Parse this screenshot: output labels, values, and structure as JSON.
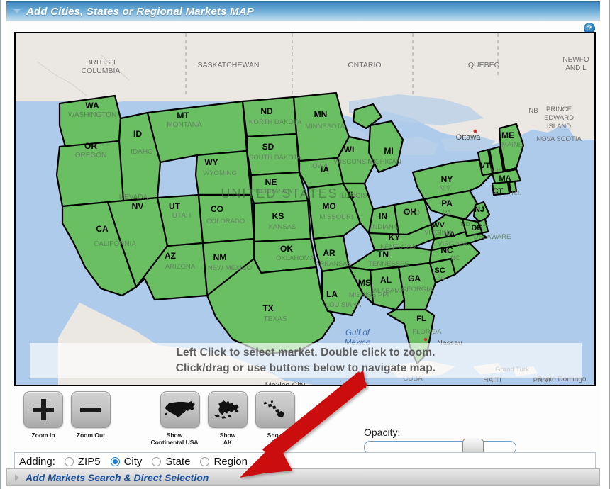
{
  "header": {
    "title": "Add Cities, States or Regional Markets MAP",
    "caret_icon": "triangle-down-icon",
    "help_icon": "help-question-icon",
    "help_label": "?"
  },
  "map": {
    "overlay_line1": "Left Click to select market. Double click to zoom.",
    "overlay_line2": "Click/drag or use buttons below to navigate map.",
    "colors": {
      "selected_state": "#6BBF63",
      "state_border": "#000000",
      "ocean": "#aecbeb",
      "land": "#ebe8e3"
    },
    "states": [
      {
        "abbr": "WA",
        "name": "WASHINGTON"
      },
      {
        "abbr": "OR",
        "name": "OREGON"
      },
      {
        "abbr": "ID",
        "name": "IDAHO"
      },
      {
        "abbr": "MT",
        "name": "MONTANA"
      },
      {
        "abbr": "ND",
        "name": "NORTH DAKOTA"
      },
      {
        "abbr": "SD",
        "name": "SOUTH DAKOTA"
      },
      {
        "abbr": "WY",
        "name": "WYOMING"
      },
      {
        "abbr": "NV",
        "name": "NEVADA"
      },
      {
        "abbr": "UT",
        "name": "UTAH"
      },
      {
        "abbr": "CO",
        "name": "COLORADO"
      },
      {
        "abbr": "CA",
        "name": "CALIFORNIA"
      },
      {
        "abbr": "AZ",
        "name": "ARIZONA"
      },
      {
        "abbr": "NM",
        "name": "NEW MEXICO"
      },
      {
        "abbr": "NE",
        "name": "NEBRASKA"
      },
      {
        "abbr": "KS",
        "name": "KANSAS"
      },
      {
        "abbr": "OK",
        "name": "OKLAHOMA"
      },
      {
        "abbr": "TX",
        "name": "TEXAS"
      },
      {
        "abbr": "MN",
        "name": "MINNESOTA"
      },
      {
        "abbr": "IA",
        "name": "IOWA"
      },
      {
        "abbr": "MO",
        "name": "MISSOURI"
      },
      {
        "abbr": "AR",
        "name": "ARKANSAS"
      },
      {
        "abbr": "LA",
        "name": "LOUISIANA"
      },
      {
        "abbr": "WI",
        "name": "WISCONSIN"
      },
      {
        "abbr": "IL",
        "name": "ILLINOIS"
      },
      {
        "abbr": "MS",
        "name": "MISSISSIPPI"
      },
      {
        "abbr": "AL",
        "name": "ALABAMA"
      },
      {
        "abbr": "MI",
        "name": "MICHIGAN"
      },
      {
        "abbr": "IN",
        "name": "INDIANA"
      },
      {
        "abbr": "OH",
        "name": "OHIO"
      },
      {
        "abbr": "KY",
        "name": "KENTUCKY"
      },
      {
        "abbr": "TN",
        "name": "TENNESSEE"
      },
      {
        "abbr": "GA",
        "name": "GEORGIA"
      },
      {
        "abbr": "FL",
        "name": "FLORIDA"
      },
      {
        "abbr": "SC",
        "name": "SC"
      },
      {
        "abbr": "NC",
        "name": "NC"
      },
      {
        "abbr": "VA",
        "name": "VIRGINIA"
      },
      {
        "abbr": "WV",
        "name": "W. VIRGINIA"
      },
      {
        "abbr": "PA",
        "name": "PA"
      },
      {
        "abbr": "NY",
        "name": "N.Y."
      },
      {
        "abbr": "VT",
        "name": "VT"
      },
      {
        "abbr": "ME",
        "name": "MAINE"
      },
      {
        "abbr": "MA",
        "name": "MA"
      },
      {
        "abbr": "CT",
        "name": "CT"
      },
      {
        "abbr": "NJ",
        "name": "N.J."
      },
      {
        "abbr": "DE",
        "name": "DELAWARE"
      },
      {
        "abbr": "MD",
        "name": "MD"
      }
    ],
    "region_labels": [
      "UNITED STATES"
    ],
    "canada_labels": [
      "BRITISH COLUMBIA",
      "SASKATCHEWAN",
      "ONTARIO",
      "QUEBEC",
      "NEWFOUNDLAND AND L",
      "PRINCE EDWARD ISLAND",
      "NOVA SCOTIA",
      "NB"
    ],
    "water_labels": [
      "Gulf of Mexico"
    ],
    "city_labels": [
      "Ottawa",
      "Nassau",
      "Mexico City",
      "Grand Turk",
      "Santo Domingo"
    ],
    "other_labels": [
      "CUBA",
      "HAITI",
      "PR VI"
    ]
  },
  "controls": {
    "zoom_in": {
      "label": "Zoom In",
      "icon": "plus-icon"
    },
    "zoom_out": {
      "label": "Zoom Out",
      "icon": "minus-icon"
    },
    "show_usa": {
      "label": "Show\nContinental USA",
      "icon": "usa-map-icon"
    },
    "show_ak": {
      "label": "Show\nAK",
      "icon": "alaska-map-icon"
    },
    "show_hi": {
      "label": "Show\nHI",
      "icon": "hawaii-map-icon"
    },
    "opacity_label": "Opacity:",
    "opacity_value": 64
  },
  "adding": {
    "lead_label": "Adding:",
    "options": [
      {
        "label": "ZIP5",
        "selected": false
      },
      {
        "label": "City",
        "selected": true
      },
      {
        "label": "State",
        "selected": false
      },
      {
        "label": "Region",
        "selected": false
      }
    ],
    "selected_color": "#1a7fd4"
  },
  "bottom": {
    "title": "Add Markets Search & Direct Selection",
    "caret_icon": "triangle-right-icon"
  },
  "annotation": {
    "arrow_icon": "red-arrow-icon",
    "arrow_color": "#cc1111"
  }
}
